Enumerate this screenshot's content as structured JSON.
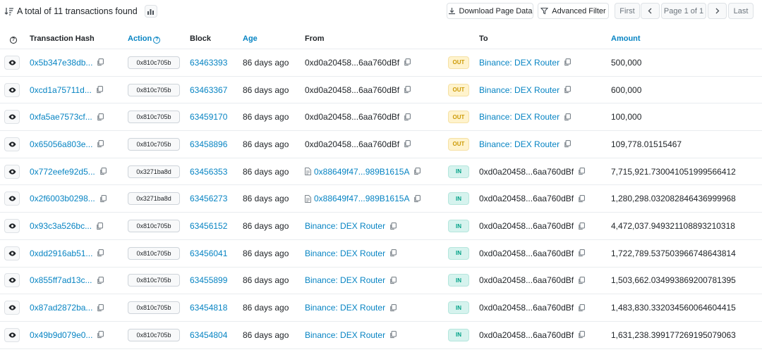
{
  "summary": {
    "text": "A total of 11 transactions found"
  },
  "toolbar": {
    "download": "Download Page Data",
    "filter": "Advanced Filter",
    "first": "First",
    "page_info": "Page 1 of 1",
    "last": "Last"
  },
  "columns": {
    "hash": "Transaction Hash",
    "action": "Action",
    "block": "Block",
    "age": "Age",
    "from": "From",
    "to": "To",
    "amount": "Amount"
  },
  "rows": [
    {
      "hash": "0x5b347e38db...",
      "method": "0x810c705b",
      "block": "63463393",
      "age": "86 days ago",
      "from": "0xd0a20458...6aa760dBf",
      "dir": "OUT",
      "to": "Binance: DEX Router",
      "amount": "500,000"
    },
    {
      "hash": "0xcd1a75711d...",
      "method": "0x810c705b",
      "block": "63463367",
      "age": "86 days ago",
      "from": "0xd0a20458...6aa760dBf",
      "dir": "OUT",
      "to": "Binance: DEX Router",
      "amount": "600,000"
    },
    {
      "hash": "0xfa5ae7573cf...",
      "method": "0x810c705b",
      "block": "63459170",
      "age": "86 days ago",
      "from": "0xd0a20458...6aa760dBf",
      "dir": "OUT",
      "to": "Binance: DEX Router",
      "amount": "100,000"
    },
    {
      "hash": "0x65056a803e...",
      "method": "0x810c705b",
      "block": "63458896",
      "age": "86 days ago",
      "from": "0xd0a20458...6aa760dBf",
      "dir": "OUT",
      "to": "Binance: DEX Router",
      "amount": "109,778.01515467"
    },
    {
      "hash": "0x772eefe92d5...",
      "method": "0x3271ba8d",
      "block": "63456353",
      "age": "86 days ago",
      "from": "0x88649f47...989B1615A",
      "dir": "IN",
      "to": "0xd0a20458...6aa760dBf",
      "amount": "7,715,921.730041051999566412"
    },
    {
      "hash": "0x2f6003b0298...",
      "method": "0x3271ba8d",
      "block": "63456273",
      "age": "86 days ago",
      "from": "0x88649f47...989B1615A",
      "dir": "IN",
      "to": "0xd0a20458...6aa760dBf",
      "amount": "1,280,298.032082846436999968"
    },
    {
      "hash": "0x93c3a526bc...",
      "method": "0x810c705b",
      "block": "63456152",
      "age": "86 days ago",
      "from": "Binance: DEX Router",
      "dir": "IN",
      "to": "0xd0a20458...6aa760dBf",
      "amount": "4,472,037.949321108893210318"
    },
    {
      "hash": "0xdd2916ab51...",
      "method": "0x810c705b",
      "block": "63456041",
      "age": "86 days ago",
      "from": "Binance: DEX Router",
      "dir": "IN",
      "to": "0xd0a20458...6aa760dBf",
      "amount": "1,722,789.537503966748643814"
    },
    {
      "hash": "0x855ff7ad13c...",
      "method": "0x810c705b",
      "block": "63455899",
      "age": "86 days ago",
      "from": "Binance: DEX Router",
      "dir": "IN",
      "to": "0xd0a20458...6aa760dBf",
      "amount": "1,503,662.034993869200781395"
    },
    {
      "hash": "0x87ad2872ba...",
      "method": "0x810c705b",
      "block": "63454818",
      "age": "86 days ago",
      "from": "Binance: DEX Router",
      "dir": "IN",
      "to": "0xd0a20458...6aa760dBf",
      "amount": "1,483,830.332034560064604415"
    },
    {
      "hash": "0x49b9d079e0...",
      "method": "0x810c705b",
      "block": "63454804",
      "age": "86 days ago",
      "from": "Binance: DEX Router",
      "dir": "IN",
      "to": "0xd0a20458...6aa760dBf",
      "amount": "1,631,238.399177269195079063"
    }
  ]
}
